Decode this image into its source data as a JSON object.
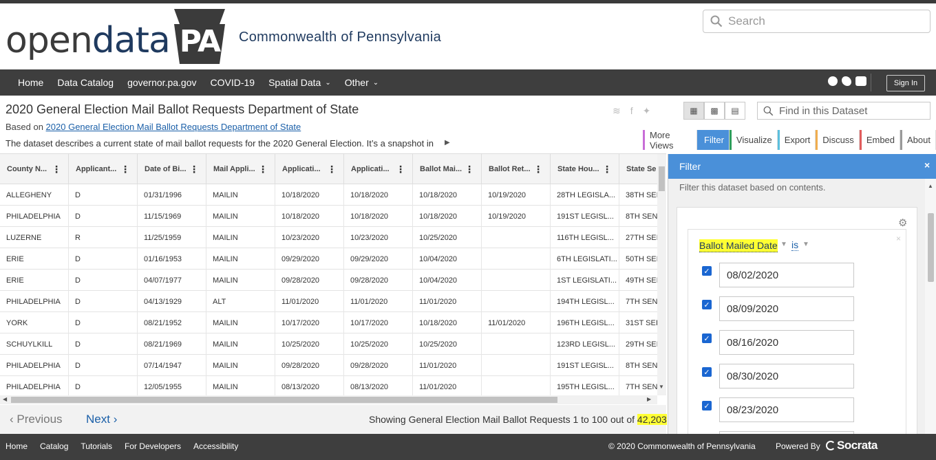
{
  "header": {
    "logo_open": "open",
    "logo_data": "data",
    "logo_pa": "PA",
    "subtitle": "Commonwealth of Pennsylvania",
    "search_placeholder": "Search"
  },
  "nav": {
    "items": [
      "Home",
      "Data Catalog",
      "governor.pa.gov",
      "COVID-19",
      "Spatial Data",
      "Other"
    ],
    "signin": "Sign In",
    "social_icons": [
      "facebook-icon",
      "twitter-icon",
      "youtube-icon"
    ]
  },
  "dataset": {
    "title": "2020 General Election Mail Ballot Requests Department of State",
    "based_prefix": "Based on ",
    "based_link": "2020 General Election Mail Ballot Requests Department of State",
    "description": "The dataset describes a current state of mail ballot requests for the 2020 General Election. It’s a snapshot in",
    "find_placeholder": "Find in this Dataset",
    "tabs": [
      "More Views",
      "Filter",
      "Visualize",
      "Export",
      "Discuss",
      "Embed",
      "About"
    ],
    "tab_colors": [
      "#c86dd7",
      "#4a90d9",
      "#2e9e5b",
      "#5bc0de",
      "#f0ad4e",
      "#e05c5c",
      "#999999"
    ]
  },
  "table": {
    "columns": [
      "County N...",
      "Applicant...",
      "Date of Bi...",
      "Mail Appli...",
      "Applicati...",
      "Applicati...",
      "Ballot Mai...",
      "Ballot Ret...",
      "State Hou...",
      "State Se"
    ],
    "rows": [
      [
        "ALLEGHENY",
        "D",
        "01/31/1996",
        "MAILIN",
        "10/18/2020",
        "10/18/2020",
        "10/18/2020",
        "10/19/2020",
        "28TH LEGISLA...",
        "38TH SEI"
      ],
      [
        "PHILADELPHIA",
        "D",
        "11/15/1969",
        "MAILIN",
        "10/18/2020",
        "10/18/2020",
        "10/18/2020",
        "10/19/2020",
        "191ST LEGISL...",
        "8TH SEN"
      ],
      [
        "LUZERNE",
        "R",
        "11/25/1959",
        "MAILIN",
        "10/23/2020",
        "10/23/2020",
        "10/25/2020",
        "",
        "116TH LEGISL...",
        "27TH SEI"
      ],
      [
        "ERIE",
        "D",
        "01/16/1953",
        "MAILIN",
        "09/29/2020",
        "09/29/2020",
        "10/04/2020",
        "",
        "6TH LEGISLATI...",
        "50TH SEI"
      ],
      [
        "ERIE",
        "D",
        "04/07/1977",
        "MAILIN",
        "09/28/2020",
        "09/28/2020",
        "10/04/2020",
        "",
        "1ST LEGISLATI...",
        "49TH SEI"
      ],
      [
        "PHILADELPHIA",
        "D",
        "04/13/1929",
        "ALT",
        "11/01/2020",
        "11/01/2020",
        "11/01/2020",
        "",
        "194TH LEGISL...",
        "7TH SEN"
      ],
      [
        "YORK",
        "D",
        "08/21/1952",
        "MAILIN",
        "10/17/2020",
        "10/17/2020",
        "10/18/2020",
        "11/01/2020",
        "196TH LEGISL...",
        "31ST SEI"
      ],
      [
        "SCHUYLKILL",
        "D",
        "08/21/1969",
        "MAILIN",
        "10/25/2020",
        "10/25/2020",
        "10/25/2020",
        "",
        "123RD LEGISL...",
        "29TH SEI"
      ],
      [
        "PHILADELPHIA",
        "D",
        "07/14/1947",
        "MAILIN",
        "09/28/2020",
        "09/28/2020",
        "11/01/2020",
        "",
        "191ST LEGISL...",
        "8TH SEN"
      ],
      [
        "PHILADELPHIA",
        "D",
        "12/05/1955",
        "MAILIN",
        "08/13/2020",
        "08/13/2020",
        "11/01/2020",
        "",
        "195TH LEGISL...",
        "7TH SEN"
      ]
    ]
  },
  "pager": {
    "prev": "Previous",
    "next": "Next",
    "showing_prefix": "Showing General Election Mail Ballot Requests 1 to 100 out of ",
    "total": "42,203"
  },
  "filter": {
    "title": "Filter",
    "close": "×",
    "subtitle": "Filter this dataset based on contents.",
    "field": "Ballot Mailed Date",
    "operator": "is",
    "values": [
      "08/02/2020",
      "08/09/2020",
      "08/16/2020",
      "08/30/2020",
      "08/23/2020"
    ]
  },
  "footer": {
    "links": [
      "Home",
      "Catalog",
      "Tutorials",
      "For Developers",
      "Accessibility"
    ],
    "copyright": "© 2020 Commonwealth of Pennsylvania",
    "powered": "Powered By",
    "brand": "Socrata"
  }
}
